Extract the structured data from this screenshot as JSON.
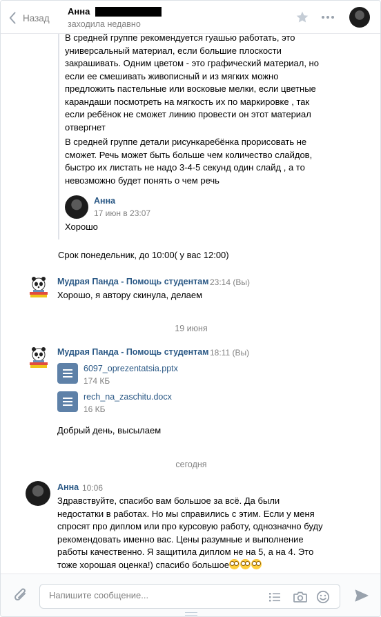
{
  "header": {
    "back_label": "Назад",
    "contact_name": "Анна",
    "status": "заходила недавно"
  },
  "quote": {
    "paragraph1": "В средней группе рекомендуется гуашью работать, это универсальный материал, если большие плоскости закрашивать. Одним цветом - это графический материал, но если ее смешивать живописный и из мягких можно предложить пастельные или восковые мелки, если цветные карандаши посмотреть на мягкость их по маркировке , так если ребёнок не сможет линию провести он этот материал отвергнет",
    "paragraph2": "В средней группе детали рисункаребёнка прорисовать не сможет. Речь может быть больше чем количество слайдов, быстро их листать не надо 3-4-5 секунд один слайд , а то невозможно будет понять о чем речь",
    "reply_author": "Анна",
    "reply_time": "17 июн в 23:07",
    "reply_text": "Хорошо"
  },
  "messages": {
    "m1_text": "Срок понедельник, до 10:00( у вас 12:00)",
    "m2_author": "Мудрая Панда - Помощь студентам",
    "m2_time": "23:14 (Вы)",
    "m2_text": "Хорошо, я автору скинула, делаем",
    "date1": "19 июня",
    "m3_author": "Мудрая Панда - Помощь студентам",
    "m3_time": "18:11 (Вы)",
    "doc1_name": "6097_oprezentatsia.pptx",
    "doc1_size": "174 КБ",
    "doc2_name": "rech_na_zaschitu.docx",
    "doc2_size": "16 КБ",
    "m3_text": "Добрый день, высылаем",
    "date2": "сегодня",
    "m4_author": "Анна",
    "m4_time": "10:06",
    "m4_text": "Здравствуйте, спасибо вам большое за всё. Да были недостатки в работах. Но мы справились с этим. Если у меня спросят про диплом или про курсовую работу, однозначно буду рекомендовать именно вас. Цены разумные и выполнение работы качественно. Я защитила диплом не на 5, а на 4. Это тоже хорошая оценка!) спасибо большое"
  },
  "composer": {
    "placeholder": "Напишите сообщение..."
  },
  "colors": {
    "link": "#2a5885",
    "muted": "#828282",
    "doc_icon": "#5e81a8"
  }
}
